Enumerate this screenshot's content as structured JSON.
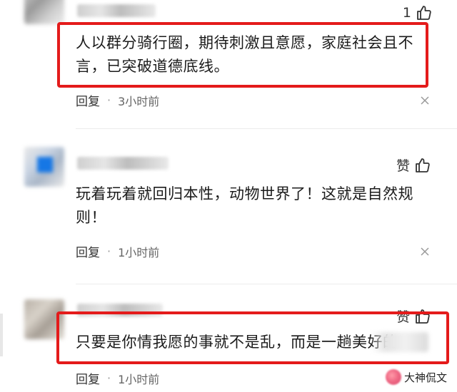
{
  "comments": [
    {
      "like_count": "1",
      "text": "人以群分骑行圈，期待刺激且意愿，家庭社会且不言，已突破道德底线。",
      "reply_label": "回复",
      "separator": "·",
      "time": "3小时前"
    },
    {
      "like_label": "赞",
      "text": "玩着玩着就回归本性，动物世界了！这就是自然规则！",
      "reply_label": "回复",
      "separator": "·",
      "time": "1小时前"
    },
    {
      "like_label": "赞",
      "text": "只要是你情我愿的事就不是乱，而是一趟美好的",
      "reply_label": "回复",
      "separator": "·",
      "time": "1小时前"
    }
  ],
  "watermark": {
    "text": "大神侃文"
  },
  "colors": {
    "highlight": "#e41b1b",
    "avatar_blue": "#1677e5"
  }
}
